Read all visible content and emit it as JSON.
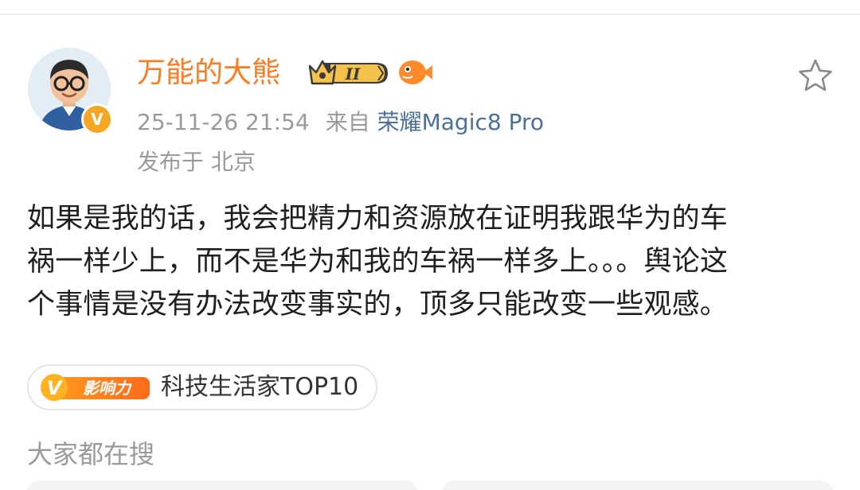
{
  "post": {
    "author": {
      "name": "万能的大熊",
      "rank": "II",
      "verified_mark": "V"
    },
    "meta": {
      "time": "25-11-26 21:54",
      "source_prefix": "来自",
      "device": "荣耀Magic8 Pro",
      "location": "发布于 北京"
    },
    "content": "如果是我的话，我会把精力和资源放在证明我跟华为的车\n祸一样少上，而不是华为和我的车祸一样多上。。。舆论这\n个事情是没有办法改变事实的，顶多只能改变一些观感。",
    "influence": {
      "logo_text": "影响力",
      "logo_letter": "V",
      "label": "科技生活家TOP10"
    }
  },
  "sections": {
    "trending_heading": "大家都在搜"
  },
  "icons": {
    "favorite": "star-outline-icon",
    "verified": "verified-v-icon",
    "rank": "crown-rank-icon",
    "fish": "fish-badge-icon"
  },
  "colors": {
    "author_name": "#ff7a1c",
    "device_link": "#4a6f9a",
    "meta_text": "#9a9a9a",
    "body_text": "#1f1f1f",
    "badge_orange": "#f6a623"
  }
}
